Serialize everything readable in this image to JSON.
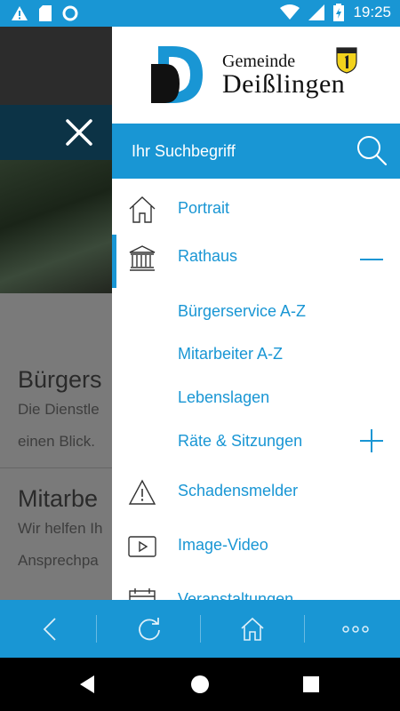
{
  "status_bar": {
    "time": "19:25",
    "color": "#1996d4"
  },
  "background_page": {
    "cards": [
      {
        "heading": "Bürgers",
        "line1": "Die Dienstle",
        "line2": "einen Blick."
      },
      {
        "heading": "Mitarbe",
        "line1": "Wir helfen Ih",
        "line2": "Ansprechpa"
      }
    ]
  },
  "drawer": {
    "logo": {
      "line1": "Gemeinde",
      "line2": "Deißlingen"
    },
    "search": {
      "placeholder": "Ihr Suchbegriff"
    },
    "menu": [
      {
        "label": "Portrait",
        "icon": "house-icon"
      },
      {
        "label": "Rathaus",
        "icon": "town-hall-icon",
        "expanded": true,
        "children": [
          {
            "label": "Bürgerservice A-Z"
          },
          {
            "label": "Mitarbeiter A-Z"
          },
          {
            "label": "Lebenslagen"
          },
          {
            "label": "Räte & Sitzungen",
            "expandable": true
          }
        ]
      },
      {
        "label": "Schadensmelder",
        "icon": "warning-icon"
      },
      {
        "label": "Image-Video",
        "icon": "play-icon"
      },
      {
        "label": "Veranstaltungen",
        "icon": "calendar-icon"
      }
    ]
  },
  "toolbar": {
    "buttons": [
      "back-icon",
      "refresh-icon",
      "home-icon",
      "more-icon"
    ]
  },
  "navbar": {
    "buttons": [
      "nav-back-icon",
      "nav-home-icon",
      "nav-recents-icon"
    ]
  },
  "colors": {
    "accent": "#1996d4",
    "dark_overlay": "#0c3346"
  }
}
